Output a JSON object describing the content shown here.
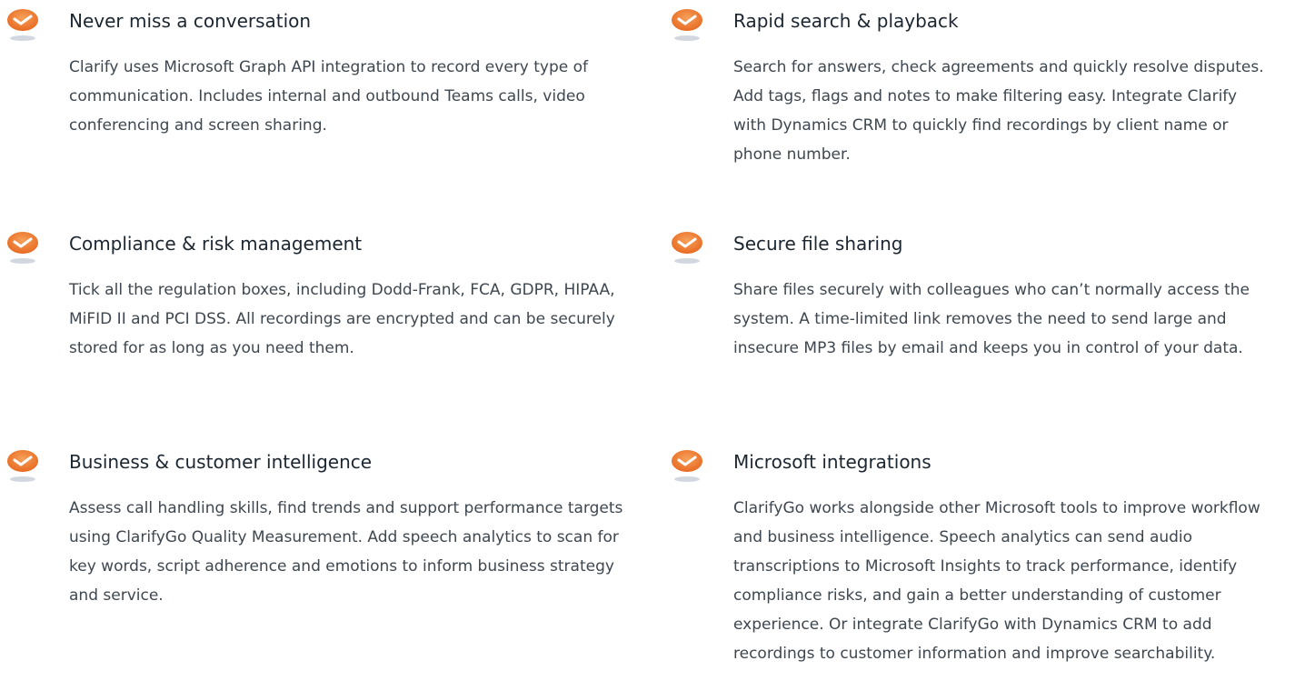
{
  "features": [
    {
      "title": "Never miss a conversation",
      "body": "Clarify uses Microsoft Graph API integration to record every type of communication. Includes internal and outbound Teams calls, video conferencing and screen sharing."
    },
    {
      "title": "Rapid search & playback",
      "body": "Search for answers, check agreements and quickly resolve disputes. Add tags, flags and notes to make filtering easy. Integrate Clarify with Dynamics CRM to quickly find recordings by client name or phone number."
    },
    {
      "title": "Compliance & risk management",
      "body": "Tick all the regulation boxes, including Dodd-Frank, FCA, GDPR, HIPAA, MiFID II and PCI DSS. All recordings are encrypted and can be securely stored for as long as you need them."
    },
    {
      "title": "Secure file sharing",
      "body": "Share files securely with colleagues who can’t normally access the system. A time-limited link removes the need to send large and insecure MP3 files by email and keeps you in control of your data."
    },
    {
      "title": "Business & customer intelligence",
      "body": "Assess call handling skills, find trends and support performance targets using ClarifyGo Quality Measurement. Add speech analytics to scan for key words, script adherence and emotions to inform business strategy and service."
    },
    {
      "title": "Microsoft integrations",
      "body": "ClarifyGo works alongside other Microsoft tools to improve workflow and business intelligence. Speech analytics can send audio transcriptions to Microsoft Insights to track performance, identify compliance risks, and gain a better understanding of customer experience. Or integrate ClarifyGo with Dynamics CRM to add recordings to customer information and improve searchability."
    }
  ],
  "icon": {
    "name": "check-badge-icon",
    "accent": "#ef7a2f",
    "shadow": "#aeb6c4"
  }
}
